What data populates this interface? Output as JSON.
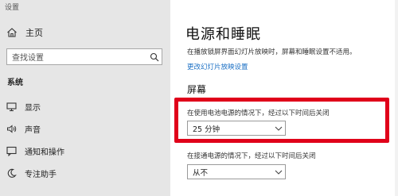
{
  "window": {
    "title": "设置"
  },
  "sidebar": {
    "home_label": "主页",
    "search": {
      "placeholder": "查找设置"
    },
    "section_label": "系统",
    "items": [
      {
        "label": "显示",
        "icon": "monitor-icon"
      },
      {
        "label": "声音",
        "icon": "speaker-icon"
      },
      {
        "label": "通知和操作",
        "icon": "notification-icon"
      },
      {
        "label": "专注助手",
        "icon": "moon-icon"
      }
    ]
  },
  "main": {
    "title": "电源和睡眠",
    "slideshow_info": "在播放锁屏界面幻灯片放映时，屏幕和睡眠设置不适用。",
    "slideshow_link": "更改幻灯片放映设置",
    "screen_heading": "屏幕",
    "battery": {
      "label": "在使用电池电源的情况下，经过以下时间后关闭",
      "value": "25 分钟"
    },
    "plugged": {
      "label": "在接通电源的情况下，经过以下时间后关闭",
      "value": "从不"
    }
  },
  "colors": {
    "sidebar_bg": "#e6e6e6",
    "highlight": "#e0001a",
    "link": "#1a6fc4"
  }
}
